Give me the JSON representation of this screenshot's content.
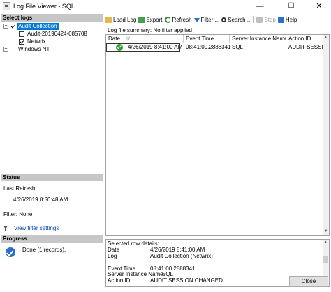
{
  "window": {
    "title": "Log File Viewer - SQL",
    "minimize_glyph": "—",
    "maximize_glyph": "☐",
    "close_glyph": "✕"
  },
  "left_pane": {
    "select_logs_header": "Select logs",
    "tree": [
      {
        "label": "Audit Collection",
        "checked": true,
        "expanded": true,
        "selected": true
      },
      {
        "label": "Audit-20190424-085708",
        "checked": false
      },
      {
        "label": "Netwrix",
        "checked": true
      },
      {
        "label": "Windows NT",
        "checked": false,
        "expanded": false
      }
    ],
    "status_header": "Status",
    "last_refresh_label": "Last Refresh:",
    "last_refresh_value": "4/26/2019 8:50:48 AM",
    "filter_label": "Filter: None",
    "view_filter_link": "View filter settings",
    "progress_header": "Progress",
    "progress_text": "Done (1 records)."
  },
  "toolbar": {
    "load_log": "Load Log",
    "export": "Export",
    "refresh": "Refresh",
    "filter": "Filter ...",
    "search": "Search ...",
    "stop": "Stop",
    "help": "Help"
  },
  "summary_text": "Log file summary: No filter applied",
  "grid": {
    "columns": [
      "Date",
      "Event Time",
      "Server Instance Name",
      "Action ID"
    ],
    "sort_glyph": "▽",
    "rows": [
      {
        "date": "4/26/2019 8:41:00 AM",
        "event_time": "08:41:00.2888341",
        "server_instance": "SQL",
        "action_id": "AUDIT SESSION C"
      }
    ]
  },
  "details": {
    "header": "Selected row details:",
    "fields": [
      {
        "label": "Date",
        "value": "4/26/2019 8:41:00 AM"
      },
      {
        "label": "Log",
        "value": "Audit Collection (Netwrix)"
      },
      {
        "label": "",
        "value": ""
      },
      {
        "label": "Event Time",
        "value": "08:41:00.2888341"
      },
      {
        "label": "Server Instance Name",
        "value": "SQL"
      },
      {
        "label": "Action ID",
        "value": "AUDIT SESSION CHANGED"
      }
    ]
  },
  "close_button": "Close",
  "colors": {
    "selection": "#0078d7",
    "section_header": "#c7c7c7",
    "link": "#0645ad",
    "success": "#2e9b2e"
  }
}
